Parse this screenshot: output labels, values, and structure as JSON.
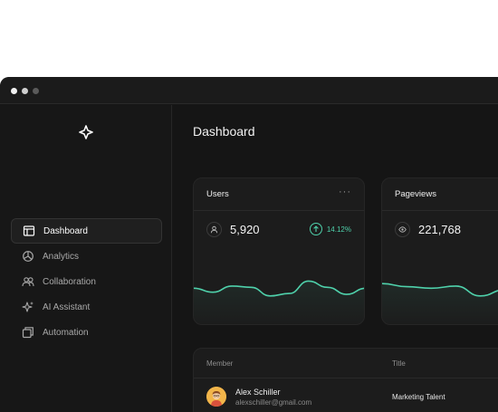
{
  "window": {
    "traffic_lights": [
      "close",
      "minimize",
      "maximize"
    ]
  },
  "sidebar": {
    "logo_icon": "sparkle-star-icon",
    "items": [
      {
        "label": "Dashboard",
        "icon": "layout-panel-icon",
        "active": true
      },
      {
        "label": "Analytics",
        "icon": "pie-chart-icon",
        "active": false
      },
      {
        "label": "Collaboration",
        "icon": "users-icon",
        "active": false
      },
      {
        "label": "AI Assistant",
        "icon": "sparkles-icon",
        "active": false
      },
      {
        "label": "Automation",
        "icon": "copy-icon",
        "active": false
      }
    ]
  },
  "main": {
    "title": "Dashboard",
    "cards": [
      {
        "title": "Users",
        "more": "···",
        "metric_icon": "user-icon",
        "value": "5,920",
        "change": "14.12%",
        "change_icon": "arrow-up-icon",
        "trend": [
          0.55,
          0.42,
          0.62,
          0.58,
          0.3,
          0.38,
          0.78,
          0.58,
          0.35,
          0.55
        ]
      },
      {
        "title": "Pageviews",
        "metric_icon": "eye-icon",
        "value": "221,768",
        "trend": [
          0.7,
          0.6,
          0.55,
          0.62,
          0.3,
          0.5,
          0.65,
          0.58
        ]
      }
    ],
    "table": {
      "columns": [
        "Member",
        "Title"
      ],
      "rows": [
        {
          "name": "Alex Schiller",
          "email": "alexschiller@gmail.com",
          "title": "Marketing Talent"
        }
      ]
    }
  },
  "colors": {
    "accent": "#4fd1ab",
    "background": "#161616",
    "card": "#1c1c1c"
  }
}
